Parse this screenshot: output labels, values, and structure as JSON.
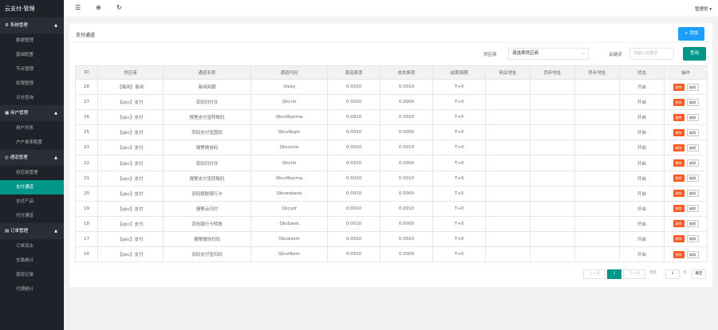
{
  "sidebar": {
    "logo": "云支付-管理",
    "groups": [
      {
        "label": "系统管理",
        "items": [
          "数据管理",
          "基础配置",
          "节点管理",
          "权限管理",
          "日志查询"
        ]
      },
      {
        "label": "用户管理",
        "items": [
          "用户列表",
          "户户费率配置"
        ]
      },
      {
        "label": "通道管理",
        "items": [
          "供应商管理",
          "支付通道",
          "支付产品",
          "代付通道"
        ]
      },
      {
        "label": "订单管理",
        "items": [
          "订单流水",
          "交易统计",
          "提现记录",
          "代理统计"
        ]
      }
    ]
  },
  "topbar": {
    "user": "管理员"
  },
  "card": {
    "title": "支付通道",
    "add_label": "+ 添加",
    "supplier_label": "供应商",
    "supplier_value": "请选择供应商",
    "keyword_label": "关键词",
    "keyword_placeholder": "请输入关键词",
    "query_label": "查询"
  },
  "table": {
    "headers": [
      "ID",
      "供应商",
      "通道名称",
      "通道代码",
      "渠道费率",
      "成本费率",
      "结算周期",
      "网关地址",
      "同步地址",
      "异步地址",
      "状态",
      "操作"
    ],
    "delete_label": "删除",
    "edit_label": "编辑",
    "rows": [
      [
        "28",
        "【易闲】易闲",
        "易闲网银",
        "Xiexy",
        "0.0010",
        "0.0010",
        "T+0",
        "",
        "",
        "",
        "开启"
      ],
      [
        "27",
        "【qkc】支付",
        "农码扫付许",
        "Qkcrki",
        "0.0010",
        "0.0000",
        "T+0",
        "",
        "",
        "",
        "开启"
      ],
      [
        "26",
        "【qkc】支付",
        "报警支付宝转账码",
        "Qkczfbzzma",
        "0.0010",
        "0.0010",
        "T+0",
        "",
        "",
        "",
        "开启"
      ],
      [
        "25",
        "【qkc】支付",
        "农码支付宝固码",
        "Qkczfbgm",
        "0.0010",
        "0.0000",
        "T+0",
        "",
        "",
        "",
        "开启"
      ],
      [
        "23",
        "【qkc】支付",
        "报警微信码",
        "Qkcsuhe",
        "0.0010",
        "0.0010",
        "T+0",
        "",
        "",
        "",
        "开启"
      ],
      [
        "22",
        "【qkc】支付",
        "农码扫付许",
        "Qkcrki",
        "0.0010",
        "0.0000",
        "T+0",
        "",
        "",
        "",
        "开启"
      ],
      [
        "21",
        "【qkc】支付",
        "报警支付宝转账码",
        "Qkczfbzzma",
        "0.0010",
        "0.0010",
        "T+0",
        "",
        "",
        "",
        "开启"
      ],
      [
        "20",
        "【qkc】支付",
        "农码银联银行卡",
        "Qkcwxbank",
        "0.0010",
        "0.0000",
        "T+0",
        "",
        "",
        "",
        "开启"
      ],
      [
        "19",
        "【qkc】支付",
        "报警云闪付",
        "Qkcysf",
        "0.0010",
        "0.0010",
        "T+0",
        "",
        "",
        "",
        "开启"
      ],
      [
        "18",
        "【qkc】支付",
        "农码银行卡转账",
        "Qkcbank",
        "0.0010",
        "0.0000",
        "T+0",
        "",
        "",
        "",
        "开启"
      ],
      [
        "17",
        "【qkc】支付",
        "报警微信扫码",
        "Qkcwxsm",
        "0.0010",
        "0.0010",
        "T+0",
        "",
        "",
        "",
        "开启"
      ],
      [
        "16",
        "【qkc】支付",
        "农码支付宝扫码",
        "Qkczfbsm",
        "0.0010",
        "0.0000",
        "T+0",
        "",
        "",
        "",
        "开启"
      ]
    ]
  },
  "pager": {
    "prev": "上一页",
    "current": "1",
    "next": "下一页",
    "goto_label": "到第",
    "page_input": "1",
    "page_unit": "页",
    "confirm": "确定"
  }
}
